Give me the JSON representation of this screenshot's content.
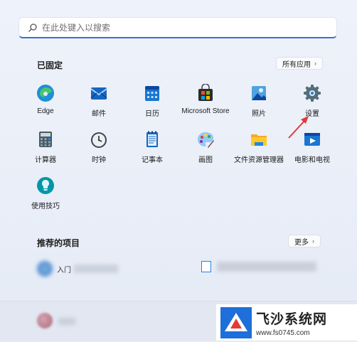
{
  "search": {
    "placeholder": "在此处键入以搜索"
  },
  "pinned": {
    "title": "已固定",
    "all_apps_label": "所有应用",
    "apps": [
      {
        "label": "Edge",
        "icon": "edge-icon"
      },
      {
        "label": "邮件",
        "icon": "mail-icon"
      },
      {
        "label": "日历",
        "icon": "calendar-icon"
      },
      {
        "label": "Microsoft Store",
        "icon": "store-icon"
      },
      {
        "label": "照片",
        "icon": "photos-icon"
      },
      {
        "label": "设置",
        "icon": "gear-icon"
      },
      {
        "label": "计算器",
        "icon": "calculator-icon"
      },
      {
        "label": "时钟",
        "icon": "clock-icon"
      },
      {
        "label": "记事本",
        "icon": "notepad-icon"
      },
      {
        "label": "画图",
        "icon": "paint-icon"
      },
      {
        "label": "文件资源管理器",
        "icon": "folder-icon"
      },
      {
        "label": "电影和电视",
        "icon": "movies-icon"
      },
      {
        "label": "使用技巧",
        "icon": "tips-icon"
      }
    ]
  },
  "recommended": {
    "title": "推荐的项目",
    "more_label": "更多",
    "items": [
      {
        "label": "入门"
      },
      {
        "label": ""
      }
    ]
  },
  "watermark": {
    "title": "飞沙系统网",
    "url": "www.fs0745.com"
  },
  "colors": {
    "accent": "#3b6ed1",
    "annotation_arrow": "#e53935"
  }
}
